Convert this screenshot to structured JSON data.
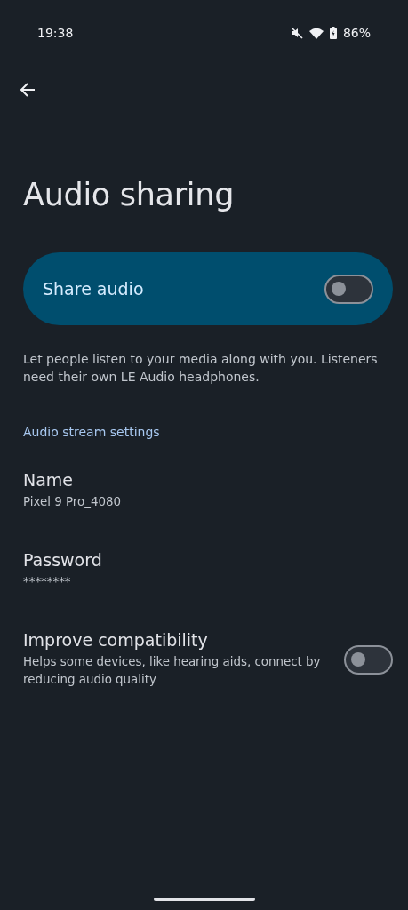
{
  "status_bar": {
    "time": "19:38",
    "battery": "86%"
  },
  "title": "Audio sharing",
  "share_audio": {
    "label": "Share audio",
    "on": false
  },
  "description": "Let people listen to your media along with you. Listeners need their own LE Audio headphones.",
  "section_header": "Audio stream settings",
  "settings": [
    {
      "kind": "text",
      "title": "Name",
      "summary": "Pixel 9 Pro_4080"
    },
    {
      "kind": "text",
      "title": "Password",
      "summary": "********"
    },
    {
      "kind": "switch",
      "title": "Improve compatibility",
      "summary": "Helps some devices, like hearing aids, connect by reducing audio quality",
      "on": false
    }
  ]
}
